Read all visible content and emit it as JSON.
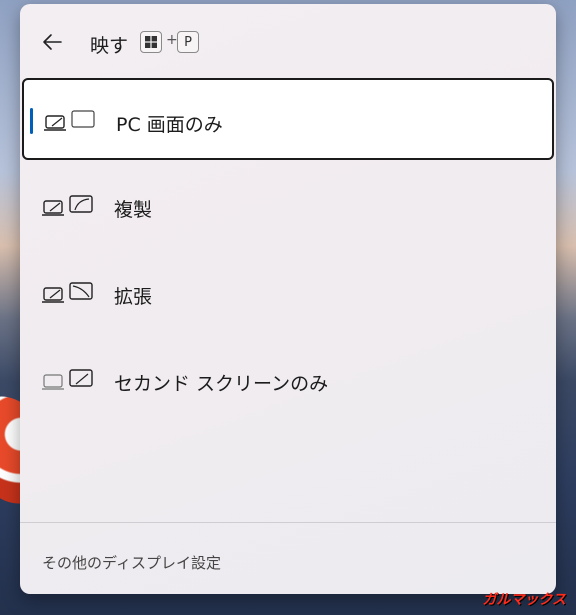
{
  "header": {
    "title": "映す",
    "shortcut_key": "P",
    "shortcut_plus": "+"
  },
  "options": [
    {
      "label": "PC 画面のみ",
      "selected": true
    },
    {
      "label": "複製",
      "selected": false
    },
    {
      "label": "拡張",
      "selected": false
    },
    {
      "label": "セカンド スクリーンのみ",
      "selected": false
    }
  ],
  "footer": {
    "link": "その他のディスプレイ設定"
  },
  "watermark": "ガルマックス",
  "colors": {
    "accent": "#005fb8",
    "selected_border": "#1b1b1b"
  }
}
